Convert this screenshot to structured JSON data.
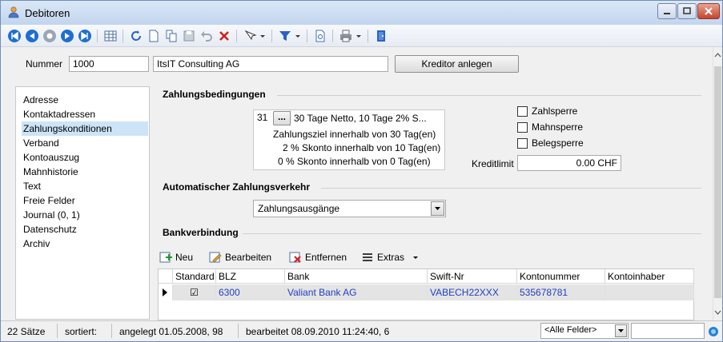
{
  "window": {
    "title": "Debitoren"
  },
  "header": {
    "nummer_label": "Nummer",
    "nummer_value": "1000",
    "name_value": "ItsIT Consulting AG",
    "kreditor_button": "Kreditor anlegen"
  },
  "nav": {
    "items": [
      {
        "label": "Adresse"
      },
      {
        "label": "Kontaktadressen"
      },
      {
        "label": "Zahlungskonditionen"
      },
      {
        "label": "Verband"
      },
      {
        "label": "Kontoauszug"
      },
      {
        "label": "Mahnhistorie"
      },
      {
        "label": "Text"
      },
      {
        "label": "Freie Felder"
      },
      {
        "label": "Journal (0, 1)"
      },
      {
        "label": "Datenschutz"
      },
      {
        "label": "Archiv"
      }
    ],
    "selected": "Zahlungskonditionen"
  },
  "zahlung": {
    "heading": "Zahlungsbedingungen",
    "code": "31",
    "code_button": "...",
    "description": "30 Tage Netto, 10 Tage 2% S...",
    "line1": "Zahlungsziel innerhalb von 30 Tag(en)",
    "line2": "2 % Skonto innerhalb von 10 Tag(en)",
    "line3": "0 % Skonto innerhalb von 0 Tag(en)",
    "zahlsperre": "Zahlsperre",
    "mahnsperre": "Mahnsperre",
    "belegsperre": "Belegsperre",
    "kreditlimit_label": "Kreditlimit",
    "kreditlimit_value": "0.00 CHF"
  },
  "auto": {
    "heading": "Automatischer Zahlungsverkehr",
    "select_value": "Zahlungsausgänge"
  },
  "bank": {
    "heading": "Bankverbindung",
    "toolbar": {
      "neu": "Neu",
      "bearbeiten": "Bearbeiten",
      "entfernen": "Entfernen",
      "extras": "Extras"
    },
    "columns": [
      "Standard",
      "BLZ",
      "Bank",
      "Swift-Nr",
      "Kontonummer",
      "Kontoinhaber"
    ],
    "rows": [
      {
        "standard": "☑",
        "blz": "6300",
        "bank": "Valiant Bank AG",
        "swift": "VABECH22XXX",
        "konto": "535678781",
        "inhaber": ""
      }
    ]
  },
  "status": {
    "count": "22 Sätze",
    "sortiert": "sortiert:",
    "angelegt": "angelegt 01.05.2008, 98",
    "bearbeitet": "bearbeitet 08.09.2010 11:24:40, 6",
    "filter": "<Alle Felder>"
  },
  "colors": {
    "accent_blue": "#1f3fc4",
    "selection": "#cce4f7"
  }
}
